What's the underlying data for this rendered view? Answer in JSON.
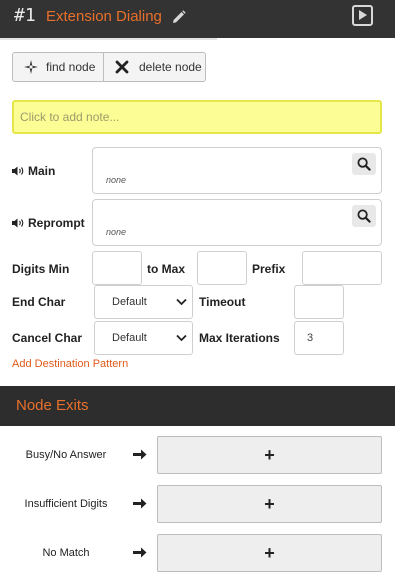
{
  "header": {
    "node_number": "#1",
    "title": "Extension Dialing",
    "edit_icon": "pencil-icon",
    "play_icon": "play-icon"
  },
  "toolbar": {
    "find_label": "find node",
    "find_icon": "crosshair-icon",
    "delete_label": "delete node",
    "delete_icon": "x-icon"
  },
  "note": {
    "placeholder": "Click to add note..."
  },
  "prompts": {
    "main": {
      "label": "Main",
      "value": "none",
      "icon": "speaker-icon"
    },
    "reprompt": {
      "label": "Reprompt",
      "value": "none",
      "icon": "speaker-icon"
    }
  },
  "digits": {
    "min_label": "Digits Min",
    "min_value": "",
    "max_label": "to Max",
    "max_value": "",
    "prefix_label": "Prefix",
    "prefix_value": ""
  },
  "end_char": {
    "label": "End Char",
    "value": "Default"
  },
  "timeout": {
    "label": "Timeout",
    "value": ""
  },
  "cancel_char": {
    "label": "Cancel Char",
    "value": "Default"
  },
  "max_iterations": {
    "label": "Max Iterations",
    "value": "3"
  },
  "add_pattern_link": "Add Destination Pattern",
  "exits": {
    "title": "Node Exits",
    "items": [
      {
        "label": "Busy/No Answer",
        "button": "+"
      },
      {
        "label": "Insufficient Digits",
        "button": "+"
      },
      {
        "label": "No Match",
        "button": "+"
      }
    ]
  },
  "colors": {
    "accent": "#e8702a",
    "header_bg": "#333333",
    "note_bg": "#fdfd96",
    "link": "#e05a1a"
  }
}
